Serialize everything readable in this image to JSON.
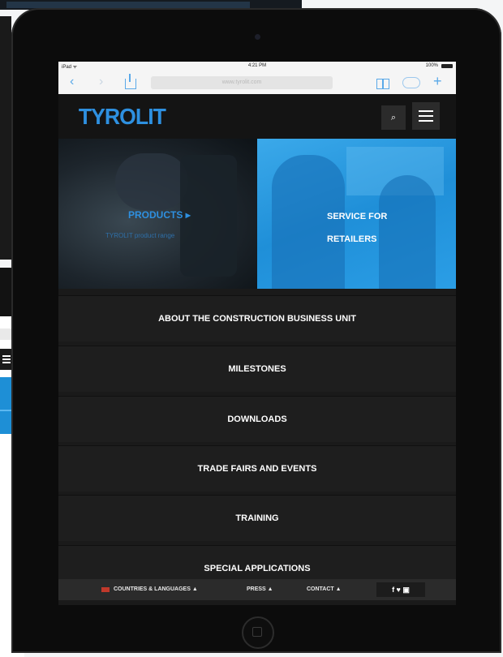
{
  "status_bar": {
    "carrier": "iPad ᯤ",
    "time": "4:21 PM",
    "battery": "100%"
  },
  "browser": {
    "url": "www.tyrolit.com",
    "back_icon": "back-arrow-icon",
    "forward_icon": "forward-arrow-icon",
    "share_icon": "share-icon",
    "bookmarks_icon": "book-icon",
    "cloud_icon": "cloud-icon",
    "new_tab_icon": "plus-icon"
  },
  "header": {
    "logo_text": "TYROLIT",
    "search_glyph": "⌕",
    "menu_icon": "hamburger-menu-icon",
    "brand_color": "#2e90e0"
  },
  "hero": {
    "products_title": "PRODUCTS",
    "products_arrow": "▸",
    "products_subtitle": "TYROLIT product range",
    "service_line1": "SERVICE FOR",
    "service_line2": "RETAILERS",
    "service_color": "#2b9ee6"
  },
  "menu": [
    {
      "label": "ABOUT THE CONSTRUCTION BUSINESS UNIT"
    },
    {
      "label": "MILESTONES"
    },
    {
      "label": "DOWNLOADS"
    },
    {
      "label": "TRADE FAIRS AND EVENTS"
    },
    {
      "label": "TRAINING"
    },
    {
      "label": "SPECIAL APPLICATIONS"
    }
  ],
  "footer": {
    "countries": "COUNTRIES & LANGUAGES ▲",
    "press": "PRESS ▲",
    "contact": "CONTACT ▲",
    "social": "f ♥ ▣"
  }
}
